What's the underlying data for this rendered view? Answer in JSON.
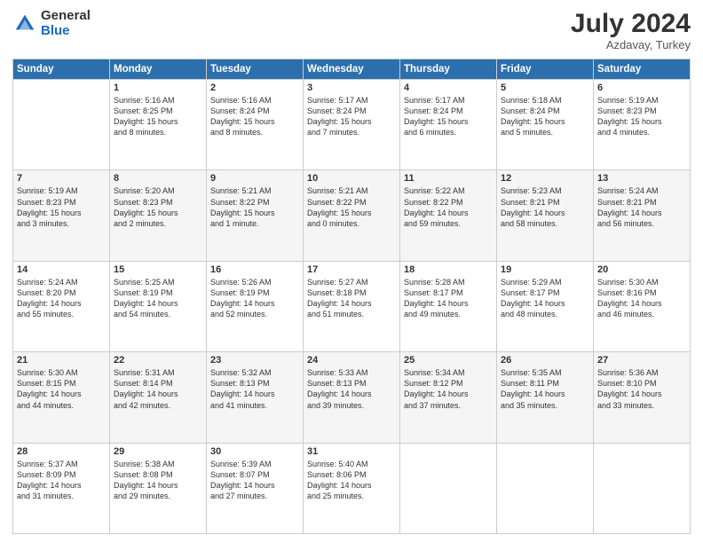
{
  "header": {
    "logo_general": "General",
    "logo_blue": "Blue",
    "month_year": "July 2024",
    "location": "Azdavay, Turkey"
  },
  "weekdays": [
    "Sunday",
    "Monday",
    "Tuesday",
    "Wednesday",
    "Thursday",
    "Friday",
    "Saturday"
  ],
  "weeks": [
    [
      {
        "day": "",
        "info": ""
      },
      {
        "day": "1",
        "info": "Sunrise: 5:16 AM\nSunset: 8:25 PM\nDaylight: 15 hours\nand 8 minutes."
      },
      {
        "day": "2",
        "info": "Sunrise: 5:16 AM\nSunset: 8:24 PM\nDaylight: 15 hours\nand 8 minutes."
      },
      {
        "day": "3",
        "info": "Sunrise: 5:17 AM\nSunset: 8:24 PM\nDaylight: 15 hours\nand 7 minutes."
      },
      {
        "day": "4",
        "info": "Sunrise: 5:17 AM\nSunset: 8:24 PM\nDaylight: 15 hours\nand 6 minutes."
      },
      {
        "day": "5",
        "info": "Sunrise: 5:18 AM\nSunset: 8:24 PM\nDaylight: 15 hours\nand 5 minutes."
      },
      {
        "day": "6",
        "info": "Sunrise: 5:19 AM\nSunset: 8:23 PM\nDaylight: 15 hours\nand 4 minutes."
      }
    ],
    [
      {
        "day": "7",
        "info": "Sunrise: 5:19 AM\nSunset: 8:23 PM\nDaylight: 15 hours\nand 3 minutes."
      },
      {
        "day": "8",
        "info": "Sunrise: 5:20 AM\nSunset: 8:23 PM\nDaylight: 15 hours\nand 2 minutes."
      },
      {
        "day": "9",
        "info": "Sunrise: 5:21 AM\nSunset: 8:22 PM\nDaylight: 15 hours\nand 1 minute."
      },
      {
        "day": "10",
        "info": "Sunrise: 5:21 AM\nSunset: 8:22 PM\nDaylight: 15 hours\nand 0 minutes."
      },
      {
        "day": "11",
        "info": "Sunrise: 5:22 AM\nSunset: 8:22 PM\nDaylight: 14 hours\nand 59 minutes."
      },
      {
        "day": "12",
        "info": "Sunrise: 5:23 AM\nSunset: 8:21 PM\nDaylight: 14 hours\nand 58 minutes."
      },
      {
        "day": "13",
        "info": "Sunrise: 5:24 AM\nSunset: 8:21 PM\nDaylight: 14 hours\nand 56 minutes."
      }
    ],
    [
      {
        "day": "14",
        "info": "Sunrise: 5:24 AM\nSunset: 8:20 PM\nDaylight: 14 hours\nand 55 minutes."
      },
      {
        "day": "15",
        "info": "Sunrise: 5:25 AM\nSunset: 8:19 PM\nDaylight: 14 hours\nand 54 minutes."
      },
      {
        "day": "16",
        "info": "Sunrise: 5:26 AM\nSunset: 8:19 PM\nDaylight: 14 hours\nand 52 minutes."
      },
      {
        "day": "17",
        "info": "Sunrise: 5:27 AM\nSunset: 8:18 PM\nDaylight: 14 hours\nand 51 minutes."
      },
      {
        "day": "18",
        "info": "Sunrise: 5:28 AM\nSunset: 8:17 PM\nDaylight: 14 hours\nand 49 minutes."
      },
      {
        "day": "19",
        "info": "Sunrise: 5:29 AM\nSunset: 8:17 PM\nDaylight: 14 hours\nand 48 minutes."
      },
      {
        "day": "20",
        "info": "Sunrise: 5:30 AM\nSunset: 8:16 PM\nDaylight: 14 hours\nand 46 minutes."
      }
    ],
    [
      {
        "day": "21",
        "info": "Sunrise: 5:30 AM\nSunset: 8:15 PM\nDaylight: 14 hours\nand 44 minutes."
      },
      {
        "day": "22",
        "info": "Sunrise: 5:31 AM\nSunset: 8:14 PM\nDaylight: 14 hours\nand 42 minutes."
      },
      {
        "day": "23",
        "info": "Sunrise: 5:32 AM\nSunset: 8:13 PM\nDaylight: 14 hours\nand 41 minutes."
      },
      {
        "day": "24",
        "info": "Sunrise: 5:33 AM\nSunset: 8:13 PM\nDaylight: 14 hours\nand 39 minutes."
      },
      {
        "day": "25",
        "info": "Sunrise: 5:34 AM\nSunset: 8:12 PM\nDaylight: 14 hours\nand 37 minutes."
      },
      {
        "day": "26",
        "info": "Sunrise: 5:35 AM\nSunset: 8:11 PM\nDaylight: 14 hours\nand 35 minutes."
      },
      {
        "day": "27",
        "info": "Sunrise: 5:36 AM\nSunset: 8:10 PM\nDaylight: 14 hours\nand 33 minutes."
      }
    ],
    [
      {
        "day": "28",
        "info": "Sunrise: 5:37 AM\nSunset: 8:09 PM\nDaylight: 14 hours\nand 31 minutes."
      },
      {
        "day": "29",
        "info": "Sunrise: 5:38 AM\nSunset: 8:08 PM\nDaylight: 14 hours\nand 29 minutes."
      },
      {
        "day": "30",
        "info": "Sunrise: 5:39 AM\nSunset: 8:07 PM\nDaylight: 14 hours\nand 27 minutes."
      },
      {
        "day": "31",
        "info": "Sunrise: 5:40 AM\nSunset: 8:06 PM\nDaylight: 14 hours\nand 25 minutes."
      },
      {
        "day": "",
        "info": ""
      },
      {
        "day": "",
        "info": ""
      },
      {
        "day": "",
        "info": ""
      }
    ]
  ]
}
